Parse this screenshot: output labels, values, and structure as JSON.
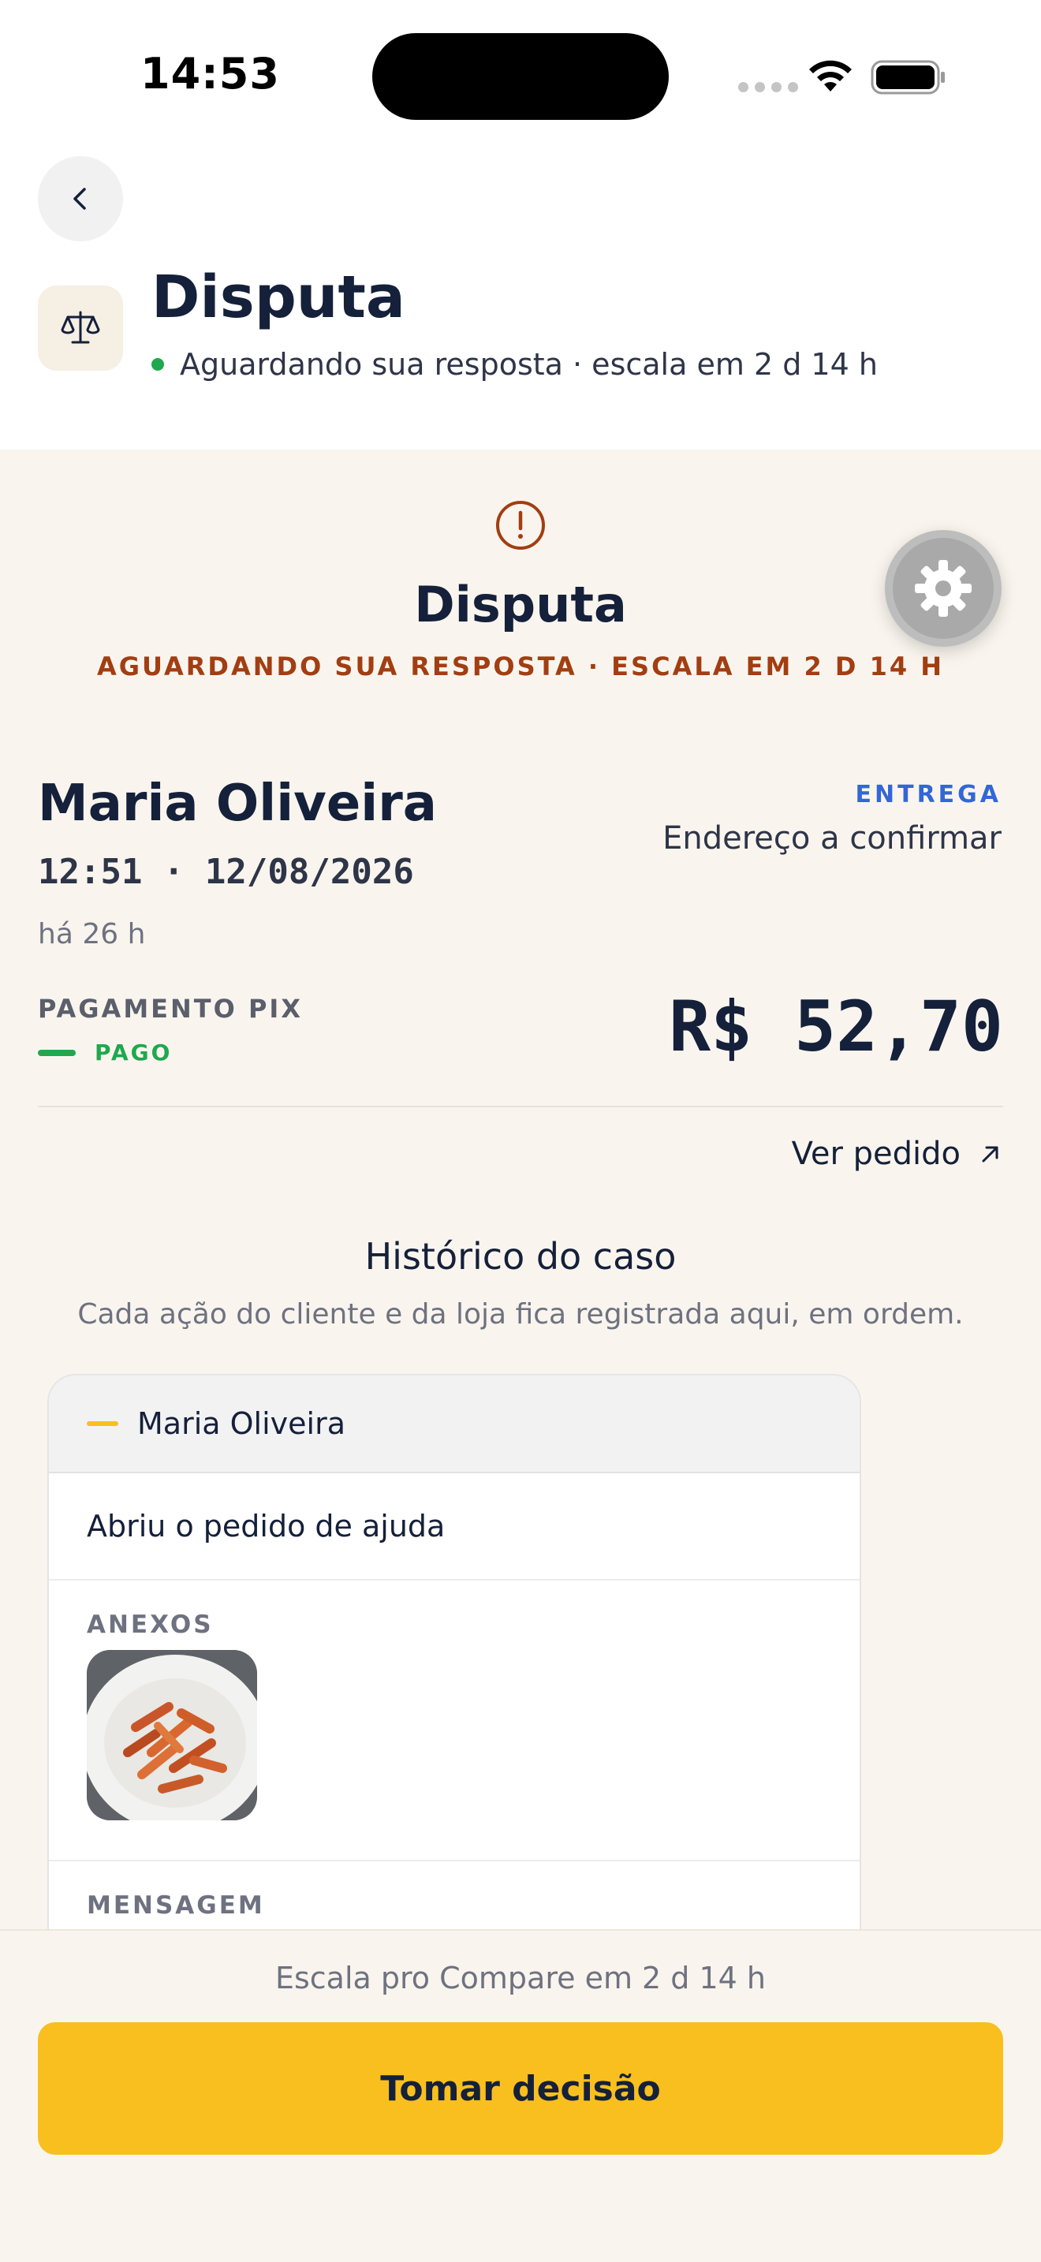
{
  "status_bar": {
    "time": "14:53"
  },
  "header": {
    "title": "Disputa",
    "subtitle": "Aguardando sua resposta · escala em 2 d 14 h",
    "status_color": "#1fa84e"
  },
  "hero": {
    "title": "Disputa",
    "status": "AGUARDANDO SUA RESPOSTA · ESCALA EM 2 D 14 H",
    "accent_color": "#a23e12"
  },
  "order": {
    "customer": "Maria Oliveira",
    "datetime": "12:51 · 12/08/2026",
    "age": "há 26 h",
    "fulfillment_label": "ENTREGA",
    "address": "Endereço a confirmar",
    "payment_label": "PAGAMENTO PIX",
    "payment_status": "PAGO",
    "total": "R$ 52,70",
    "view_order_label": "Ver pedido"
  },
  "history": {
    "title": "Histórico do caso",
    "subtitle": "Cada ação do cliente e da loja fica registrada aqui, em ordem.",
    "entries": [
      {
        "author": "Maria Oliveira",
        "action": "Abriu o pedido de ajuda",
        "attachments_label": "ANEXOS",
        "message_label": "MENSAGEM"
      }
    ]
  },
  "footer": {
    "escalation_note": "Escala pro Compare em 2 d 14 h",
    "decision_button": "Tomar decisão",
    "button_color": "#f9bf1e"
  },
  "icons": [
    "chevron-left-icon",
    "scale-icon",
    "alert-circle-icon",
    "gear-icon",
    "arrow-up-right-icon",
    "wifi-icon",
    "battery-icon"
  ]
}
